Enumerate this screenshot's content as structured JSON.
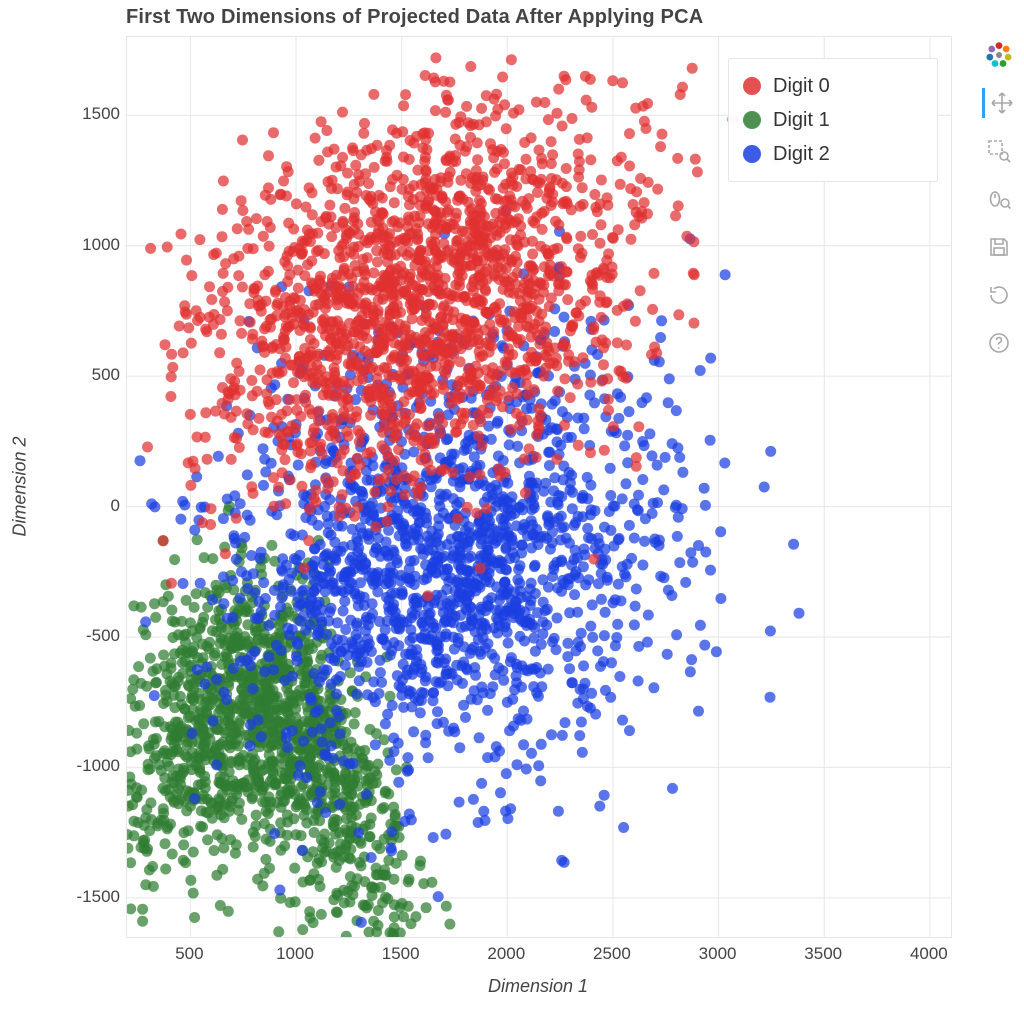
{
  "chart_data": {
    "type": "scatter",
    "title": "First Two Dimensions of Projected Data After Applying PCA",
    "xlabel": "Dimension 1",
    "ylabel": "Dimension 2",
    "xlim": [
      200,
      4100
    ],
    "ylim": [
      -1650,
      1800
    ],
    "grid": true,
    "legend_position": "top-right",
    "series": [
      {
        "name": "Digit 0",
        "color": "#e03131",
        "cluster": {
          "n": 1800,
          "cx": 1600,
          "cy": 800,
          "sx": 520,
          "sy": 330,
          "rot": 20
        }
      },
      {
        "name": "Digit 1",
        "color": "#2f7d32",
        "cluster": {
          "n": 1500,
          "cx": 850,
          "cy": -900,
          "sx": 420,
          "sy": 260,
          "rot": -30,
          "arc": true
        }
      },
      {
        "name": "Digit 2",
        "color": "#1a3fe0",
        "cluster": {
          "n": 1700,
          "cx": 1700,
          "cy": -200,
          "sx": 520,
          "sy": 420,
          "rot": 10
        }
      }
    ],
    "xticks": [
      500,
      1000,
      1500,
      2000,
      2500,
      3000,
      3500,
      4000
    ],
    "yticks": [
      -1500,
      -1000,
      -500,
      0,
      500,
      1000,
      1500
    ]
  },
  "legend": {
    "items": [
      {
        "label": "Digit 0",
        "color": "#e03131"
      },
      {
        "label": "Digit 1",
        "color": "#2f7d32"
      },
      {
        "label": "Digit 2",
        "color": "#1a3fe0"
      }
    ]
  },
  "toolbar": {
    "tools": [
      {
        "id": "pan-tool",
        "label": "Pan",
        "active": true
      },
      {
        "id": "boxzoom-tool",
        "label": "Box Zoom",
        "active": false
      },
      {
        "id": "wheelzoom-tool",
        "label": "Wheel Zoom",
        "active": false
      },
      {
        "id": "save-tool",
        "label": "Save",
        "active": false
      },
      {
        "id": "reset-tool",
        "label": "Reset",
        "active": false
      },
      {
        "id": "help-tool",
        "label": "Help",
        "active": false
      }
    ]
  }
}
